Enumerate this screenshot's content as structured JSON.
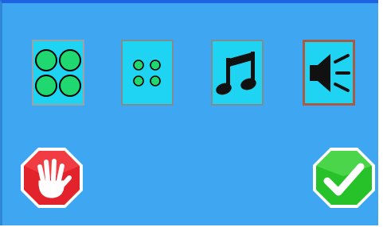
{
  "colors": {
    "panel_background": "#3fa7f2",
    "panel_top_border": "#1e63e0",
    "option_background": "#1fd3f3",
    "dot_fill": "#1fd870",
    "cancel_red": "#e3232b",
    "confirm_green": "#27c229"
  },
  "options": [
    {
      "id": "large-dots",
      "icon": "large-dots-icon",
      "selected": false
    },
    {
      "id": "small-dots",
      "icon": "small-dots-icon",
      "selected": false
    },
    {
      "id": "music",
      "icon": "music-note-icon",
      "selected": false
    },
    {
      "id": "sound",
      "icon": "speaker-icon",
      "selected": true
    }
  ],
  "actions": {
    "cancel_icon": "stop-hand-icon",
    "confirm_icon": "checkmark-icon"
  }
}
